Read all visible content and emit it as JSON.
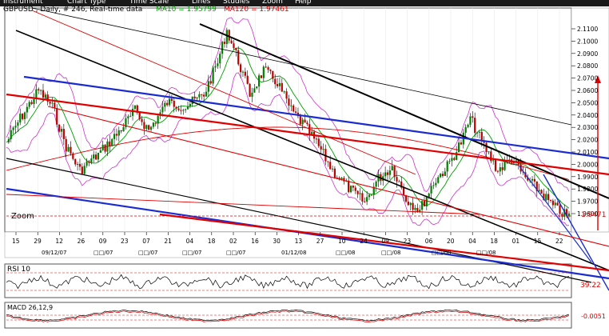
{
  "menu": {
    "items": [
      "Instrument",
      "Chart Type",
      "Time Scale",
      "Lines",
      "Studies",
      "Zoom",
      "Help"
    ]
  },
  "header": {
    "symbol_info": "GBPUSD , Daily, # 246, Real-time data",
    "ma10_label": "MA10 = 1.95799",
    "ma120_label": "MA120 = 1.97461",
    "ma10_color": "#00a000",
    "ma120_color": "#e00000"
  },
  "zoom_label": "Zoom",
  "price_axis": {
    "labels": [
      "2.1100",
      "2.1000",
      "2.0900",
      "2.0800",
      "2.0700",
      "2.0600",
      "2.0500",
      "2.0400",
      "2.0300",
      "2.0200",
      "2.0100",
      "2.0000",
      "1.9900",
      "1.9800",
      "1.9700",
      "1.9600"
    ],
    "current_price": "1.9471",
    "current_price_color": "#e00000"
  },
  "date_axis": {
    "days": [
      "15",
      "29",
      "12",
      "26",
      "09",
      "23",
      "07",
      "21",
      "04",
      "18",
      "02",
      "16",
      "30",
      "13",
      "27",
      "10",
      "24",
      "09",
      "23",
      "06",
      "20",
      "04",
      "18",
      "01",
      "15",
      "22"
    ],
    "months": [
      "09/12/07",
      "□□/07",
      "□□/07",
      "□□/07",
      "□□/07",
      "01/12/08",
      "□□/08",
      "□□/08",
      "□□/08",
      "□□/08"
    ]
  },
  "rsi_panel": {
    "label": "RSI 10",
    "value_label": "39.22"
  },
  "macd_panel": {
    "label": "MACD 26,12,9",
    "value_label": "-0.0051"
  },
  "colors": {
    "menubar": "#1a1a1a",
    "candle_up": "#008000",
    "candle_down": "#c00000",
    "trend_black": "#000000",
    "trend_blue": "#1a2ccf",
    "trend_red": "#e00000",
    "bollinger": "#cc33cc"
  }
}
